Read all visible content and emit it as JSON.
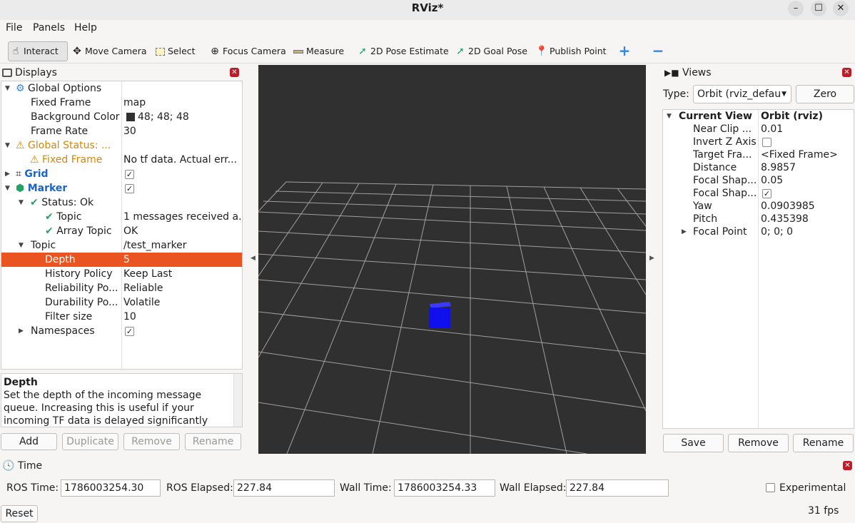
{
  "window": {
    "title": "RViz*"
  },
  "menu": [
    "File",
    "Panels",
    "Help"
  ],
  "toolbar": {
    "tools": [
      {
        "label": "Interact",
        "icon": "hand-pointer-icon"
      },
      {
        "label": "Move Camera",
        "icon": "move-arrows-icon"
      },
      {
        "label": "Select",
        "icon": "select-rect-icon"
      },
      {
        "label": "Focus Camera",
        "icon": "focus-target-icon"
      },
      {
        "label": "Measure",
        "icon": "ruler-icon"
      },
      {
        "label": "2D Pose Estimate",
        "icon": "green-arrow-icon"
      },
      {
        "label": "2D Goal Pose",
        "icon": "green-arrow-icon"
      },
      {
        "label": "Publish Point",
        "icon": "map-pin-icon"
      }
    ],
    "add_symbol": "+",
    "remove_symbol": "−"
  },
  "displays": {
    "title": "Displays",
    "rows": [
      {
        "label": "Global Options",
        "value": ""
      },
      {
        "label": "Fixed Frame",
        "value": "map"
      },
      {
        "label": "Background Color",
        "value": "48; 48; 48"
      },
      {
        "label": "Frame Rate",
        "value": "30"
      },
      {
        "label": "Global Status: ...",
        "value": ""
      },
      {
        "label": "Fixed Frame",
        "value": "No tf data.  Actual err..."
      },
      {
        "label": "Grid",
        "value": ""
      },
      {
        "label": "Marker",
        "value": ""
      },
      {
        "label": "Status: Ok",
        "value": ""
      },
      {
        "label": "Topic",
        "value": "1 messages received a..."
      },
      {
        "label": "Array Topic",
        "value": "OK"
      },
      {
        "label": "Topic",
        "value": "/test_marker"
      },
      {
        "label": "Depth",
        "value": "5"
      },
      {
        "label": "History Policy",
        "value": "Keep Last"
      },
      {
        "label": "Reliability Po...",
        "value": "Reliable"
      },
      {
        "label": "Durability Po...",
        "value": "Volatile"
      },
      {
        "label": "Filter size",
        "value": "10"
      },
      {
        "label": "Namespaces",
        "value": ""
      }
    ],
    "description": {
      "title": "Depth",
      "text": "Set the depth of the incoming message queue. Increasing this is useful if your incoming TF data is delayed significantly from your message"
    },
    "buttons": {
      "add": "Add",
      "duplicate": "Duplicate",
      "remove": "Remove",
      "rename": "Rename"
    }
  },
  "views": {
    "title": "Views",
    "type_label": "Type:",
    "type_value": "Orbit (rviz_defau",
    "zero_label": "Zero",
    "header": {
      "label": "Current View",
      "value": "Orbit (rviz)"
    },
    "rows": [
      {
        "label": "Near Clip ...",
        "value": "0.01"
      },
      {
        "label": "Invert Z Axis",
        "value": ""
      },
      {
        "label": "Target Fra...",
        "value": "<Fixed Frame>"
      },
      {
        "label": "Distance",
        "value": "8.9857"
      },
      {
        "label": "Focal Shap...",
        "value": "0.05"
      },
      {
        "label": "Focal Shap...",
        "value": ""
      },
      {
        "label": "Yaw",
        "value": "0.0903985"
      },
      {
        "label": "Pitch",
        "value": "0.435398"
      },
      {
        "label": "Focal Point",
        "value": "0; 0; 0"
      }
    ],
    "buttons": {
      "save": "Save",
      "remove": "Remove",
      "rename": "Rename"
    }
  },
  "time": {
    "title": "Time",
    "ros_time_label": "ROS Time:",
    "ros_time": "1786003254.30",
    "ros_elapsed_label": "ROS Elapsed:",
    "ros_elapsed": "227.84",
    "wall_time_label": "Wall Time:",
    "wall_time": "1786003254.33",
    "wall_elapsed_label": "Wall Elapsed:",
    "wall_elapsed": "227.84",
    "experimental_label": "Experimental",
    "reset_label": "Reset",
    "fps": "31 fps"
  },
  "colors": {
    "background": "#303030",
    "selection": "#e95420",
    "marker": "#0000ff"
  }
}
